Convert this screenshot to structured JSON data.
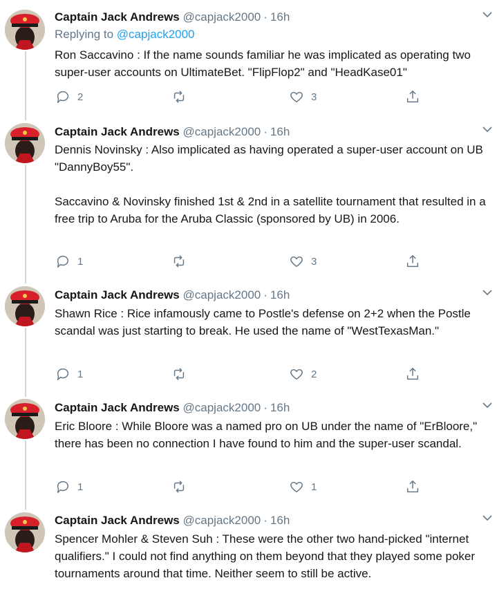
{
  "avatar_desc": "user-avatar",
  "reply_prefix": "Replying to",
  "tweets": [
    {
      "name": "Captain Jack Andrews",
      "handle": "@capjack2000",
      "dot": "·",
      "time": "16h",
      "replying_to": "@capjack2000",
      "text": "Ron Saccavino : If the name sounds familiar he was implicated as operating two super-user accounts on UltimateBet. \"FlipFlop2\" and \"HeadKase01\"",
      "replies": "2",
      "retweets": "",
      "likes": "3"
    },
    {
      "name": "Captain Jack Andrews",
      "handle": "@capjack2000",
      "dot": "·",
      "time": "16h",
      "text": "Dennis Novinsky : Also implicated as having operated a super-user account on UB \"DannyBoy55\".\n\nSaccavino & Novinsky finished 1st & 2nd in a satellite tournament that resulted in a free trip to Aruba for the Aruba Classic (sponsored by UB) in 2006.",
      "replies": "1",
      "retweets": "",
      "likes": "3"
    },
    {
      "name": "Captain Jack Andrews",
      "handle": "@capjack2000",
      "dot": "·",
      "time": "16h",
      "text": "Shawn Rice : Rice infamously came to Postle's defense on 2+2 when the Postle scandal was just starting to break. He used the name of \"WestTexasMan.\"",
      "replies": "1",
      "retweets": "",
      "likes": "2"
    },
    {
      "name": "Captain Jack Andrews",
      "handle": "@capjack2000",
      "dot": "·",
      "time": "16h",
      "text": "Eric Bloore : While Bloore was a named pro on UB under the name of \"ErBloore,\" there has been no connection I have found to him and the super-user scandal.",
      "replies": "1",
      "retweets": "",
      "likes": "1"
    },
    {
      "name": "Captain Jack Andrews",
      "handle": "@capjack2000",
      "dot": "·",
      "time": "16h",
      "text": "Spencer Mohler & Steven Suh : These were the other two hand-picked \"internet qualifiers.\" I could not find anything on them beyond that they played some poker tournaments around that time. Neither seem to still be active.",
      "replies": "",
      "retweets": "",
      "likes": ""
    }
  ]
}
